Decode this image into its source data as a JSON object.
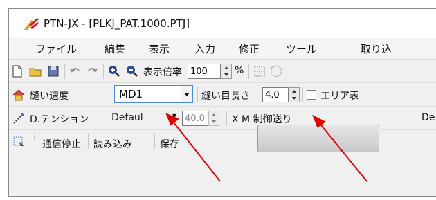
{
  "window": {
    "title": "PTN-JX - [PLKJ_PAT.1000.PTJ]"
  },
  "menu": {
    "items": [
      "ファイル",
      "編集",
      "表示",
      "入力",
      "修正",
      "ツール",
      "取り込"
    ]
  },
  "toolbar1": {
    "zoom_label": "表示倍率",
    "zoom_value": "100",
    "zoom_unit": "%"
  },
  "toolbar2": {
    "speed_label": "縫い速度",
    "speed_value": "MD1",
    "stitch_length_label": "縫い目長さ",
    "stitch_length_value": "4.0",
    "area_label": "エリア表"
  },
  "toolbar3": {
    "tension_label": "D.テンション",
    "tension_value": "Defaul",
    "tension_number": "40.0",
    "feed_label": "X M   制御送り",
    "feed_value": "De"
  },
  "toolbar4": {
    "stop_comm": "通信停止",
    "read": "読み込み",
    "save": "保存"
  },
  "colors": {
    "arrow": "#e00000",
    "combo_border": "#4a8ad8"
  }
}
